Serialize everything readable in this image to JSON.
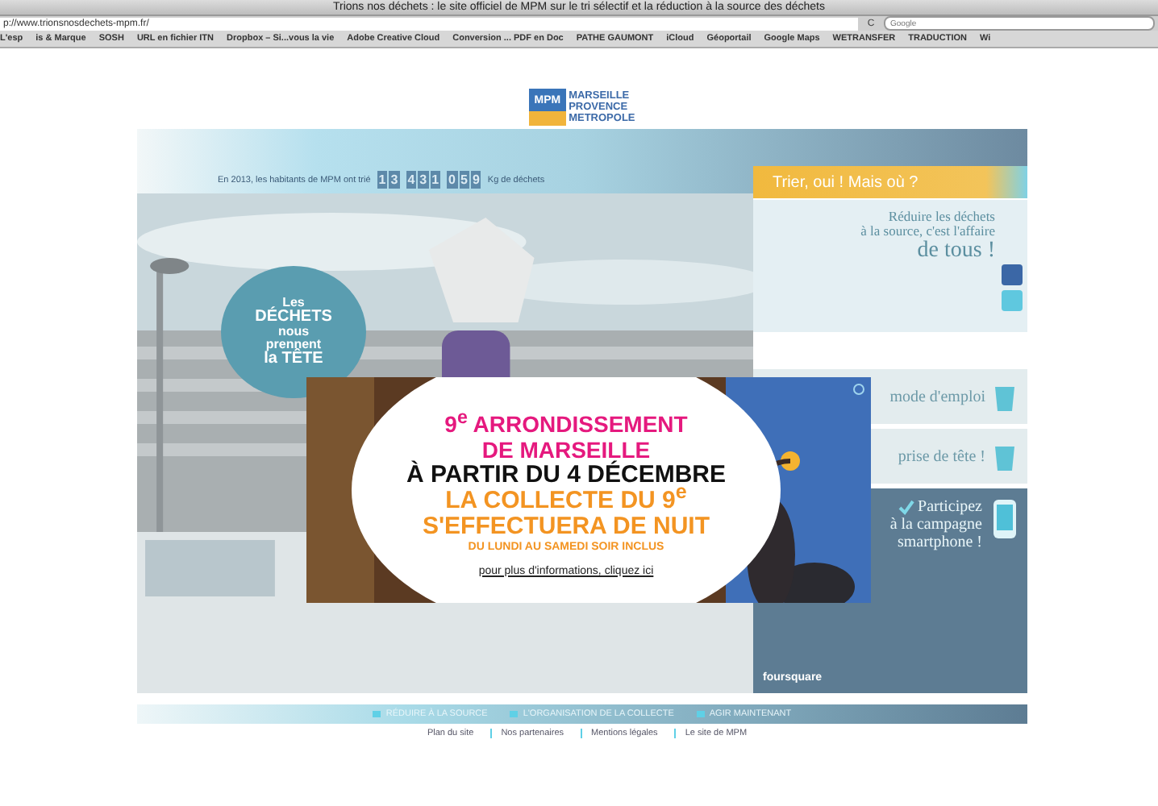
{
  "window": {
    "title": "Trions nos déchets : le site officiel de MPM sur le tri sélectif et la réduction à la source des déchets"
  },
  "address_bar": {
    "url": "p://www.trionsnosdechets-mpm.fr/",
    "reload": "C",
    "search_placeholder": "Google"
  },
  "bookmarks": [
    "L'esp",
    "is & Marque",
    "SOSH",
    "URL en fichier ITN",
    "Dropbox – Si...vous la vie",
    "Adobe Creative Cloud",
    "Conversion ... PDF en Doc",
    "PATHE GAUMONT",
    "iCloud",
    "Géoportail",
    "Google Maps",
    "WETRANSFER",
    "TRADUCTION",
    "Wi"
  ],
  "logo": {
    "mark": "MPM",
    "lines": [
      "MARSEILLE",
      "PROVENCE",
      "METROPOLE"
    ]
  },
  "counter": {
    "prefix": "En 2013, les habitants de MPM ont trié",
    "groups": [
      [
        "1",
        "3"
      ],
      [
        "4",
        "3",
        "1"
      ],
      [
        "0",
        "5",
        "9"
      ]
    ],
    "suffix": "Kg de déchets"
  },
  "where_button": "Trier, oui ! Mais où ?",
  "bubble": [
    "Les",
    "DÉCHETS",
    "nous",
    "prennent",
    "la TÊTE"
  ],
  "panels": [
    {
      "kind": "intro",
      "lines": [
        "Réduire les déchets",
        "à la source, c'est l'affaire"
      ],
      "highlight": "de tous !"
    },
    {
      "kind": "card",
      "lines": [
        "mode d'emploi"
      ]
    },
    {
      "kind": "card",
      "lines": [
        "prise de tête !"
      ]
    },
    {
      "kind": "smartphone",
      "lines": [
        "Participez",
        "à la campagne",
        "smartphone !"
      ],
      "brand": "foursquare"
    }
  ],
  "popup": {
    "lines": [
      {
        "kind": "pink",
        "text": "9$^{e}$ ARRONDISSEMENT"
      },
      {
        "kind": "pink",
        "text": "DE MARSEILLE"
      },
      {
        "kind": "black",
        "text": "À PARTIR DU 4 DÉCEMBRE"
      },
      {
        "kind": "orange",
        "text": "LA COLLECTE DU 9$^{e}$"
      },
      {
        "kind": "orange",
        "text": "S'EFFECTUERA DE NUIT"
      },
      {
        "kind": "small",
        "text": "DU LUNDI AU SAMEDI SOIR INCLUS"
      }
    ],
    "link": "pour plus d'informations, cliquez ici"
  },
  "nav": [
    "RÉDUIRE À LA SOURCE",
    "L'ORGANISATION DE LA COLLECTE",
    "AGIR MAINTENANT"
  ],
  "footer": [
    "Plan du site",
    "Nos partenaires",
    "Mentions légales",
    "Le site de MPM"
  ]
}
